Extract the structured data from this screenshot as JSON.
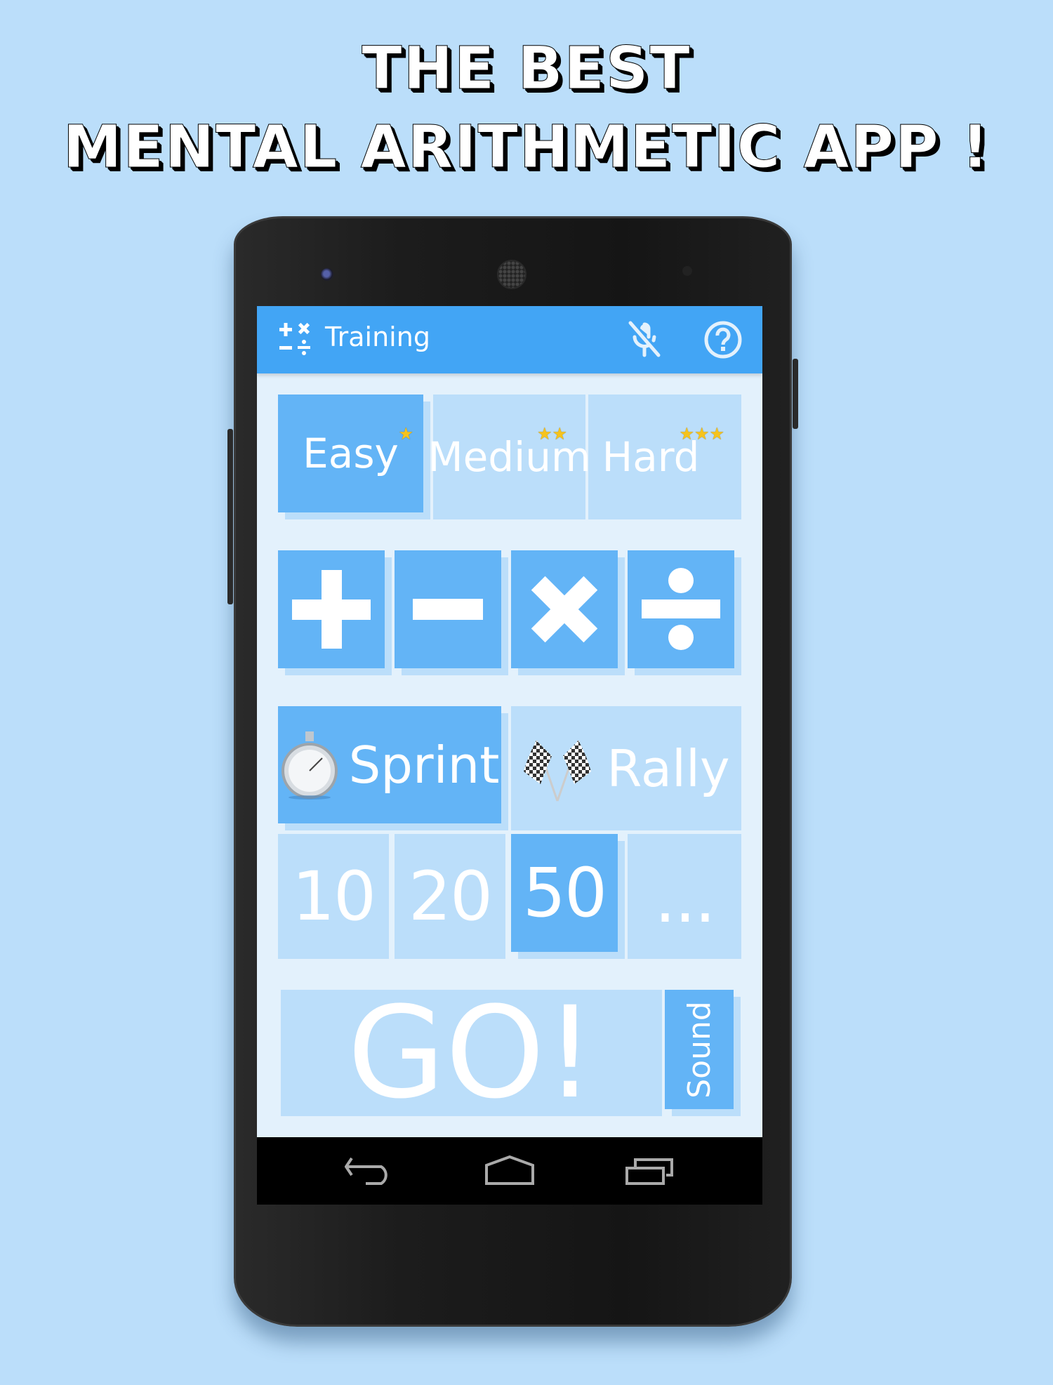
{
  "promo": {
    "line1": "THE BEST",
    "line2": "MENTAL ARITHMETIC APP !"
  },
  "appbar": {
    "title": "Training",
    "app_icon": "arithmetic-operators-icon",
    "actions": [
      {
        "name": "mic-off-icon",
        "label": "Voice input off"
      },
      {
        "name": "help-icon",
        "label": "Help"
      }
    ]
  },
  "difficulty": {
    "options": [
      {
        "label": "Easy",
        "stars": 1,
        "selected": true
      },
      {
        "label": "Medium",
        "stars": 2,
        "selected": false
      },
      {
        "label": "Hard",
        "stars": 3,
        "selected": false
      }
    ]
  },
  "operations": {
    "options": [
      {
        "symbol": "+",
        "name": "addition",
        "selected": true
      },
      {
        "symbol": "−",
        "name": "subtraction",
        "selected": true
      },
      {
        "symbol": "×",
        "name": "multiplication",
        "selected": true
      },
      {
        "symbol": "÷",
        "name": "division",
        "selected": true
      }
    ]
  },
  "modes": {
    "options": [
      {
        "label": "Sprint",
        "icon": "stopwatch-icon",
        "selected": true
      },
      {
        "label": "Rally",
        "icon": "checkered-flags-icon",
        "selected": false
      }
    ]
  },
  "counts": {
    "options": [
      {
        "label": "10",
        "selected": false
      },
      {
        "label": "20",
        "selected": false
      },
      {
        "label": "50",
        "selected": true
      },
      {
        "label": "...",
        "selected": false
      }
    ]
  },
  "actions": {
    "go_label": "GO!",
    "sound_label": "Sound",
    "sound_selected": true
  },
  "colors": {
    "background": "#bbdefa",
    "appbar": "#42a5f5",
    "selected_tile": "#63b4f6",
    "unselected_tile": "#bbdefa",
    "screen_bg": "#e3f1fc",
    "star": "#f6c31c"
  },
  "system_nav": [
    "back",
    "home",
    "recents"
  ]
}
